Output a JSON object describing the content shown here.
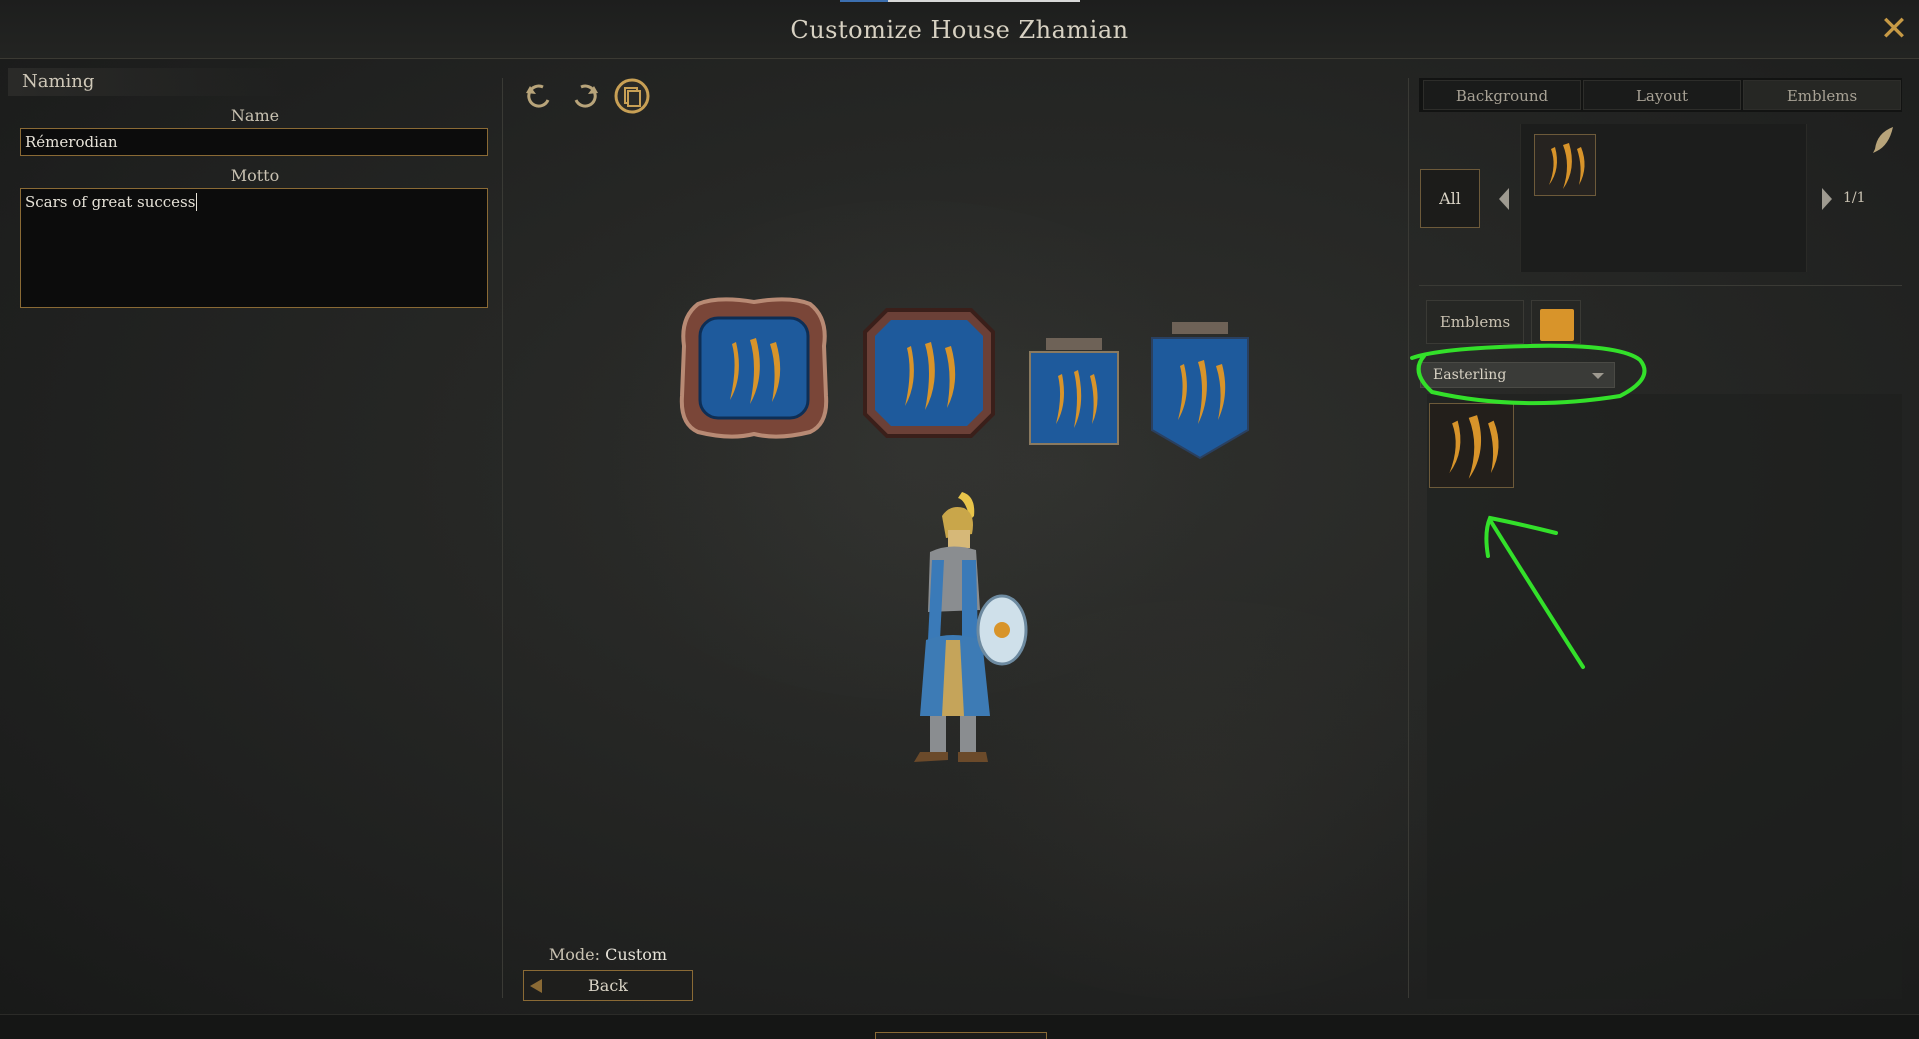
{
  "window": {
    "title": "Customize House Zhamian"
  },
  "naming": {
    "section": "Naming",
    "name_label": "Name",
    "name_value": "Rémerodian",
    "motto_label": "Motto",
    "motto_value": "Scars of great success"
  },
  "toolbar": {
    "icons": [
      "undo-icon",
      "redo-icon",
      "randomize-icon"
    ]
  },
  "preview": {
    "mode_label": "Mode:",
    "mode_value": "Custom",
    "back_label": "Back"
  },
  "right": {
    "tabs": [
      {
        "label": "Background"
      },
      {
        "label": "Layout"
      },
      {
        "label": "Emblems"
      }
    ],
    "active_tab": "Emblems",
    "all_label": "All",
    "page": "1/1",
    "emblems_btn": "Emblems",
    "dropdown_value": "Easterling"
  },
  "colors": {
    "emblem": "#d8942a",
    "banner_blue": "#1e5a9c",
    "accent_gold": "#8a6a35",
    "annotation": "#33e02a"
  }
}
